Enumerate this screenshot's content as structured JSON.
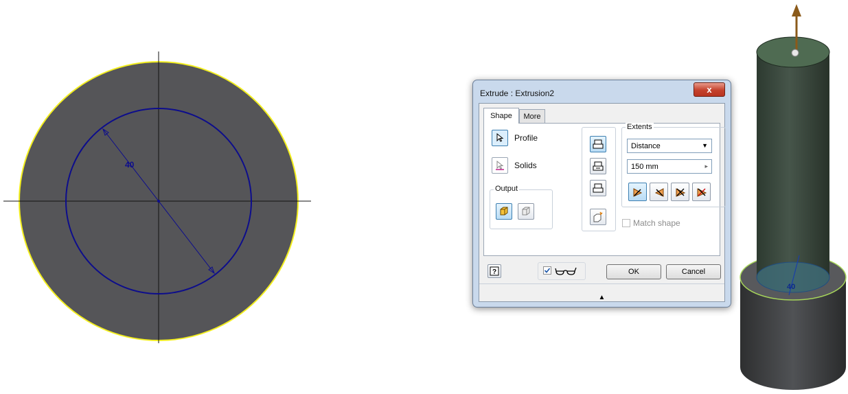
{
  "sketch": {
    "dimension_label": "40"
  },
  "dialog": {
    "title": "Extrude : Extrusion2",
    "close_glyph": "x",
    "tabs": [
      {
        "label": "Shape"
      },
      {
        "label": "More"
      }
    ],
    "profile_label": "Profile",
    "solids_label": "Solids",
    "output": {
      "title": "Output",
      "options": [
        "solid-output-icon",
        "surface-output-icon"
      ]
    },
    "operations": [
      "join-icon",
      "cut-icon",
      "intersect-icon",
      "new-solid-icon"
    ],
    "extents": {
      "title": "Extents",
      "type_value": "Distance",
      "distance_value": "150 mm",
      "direction_icons": [
        "direction-1-icon",
        "direction-2-icon",
        "symmetric-icon",
        "asymmetric-icon"
      ]
    },
    "match_shape_label": "Match shape",
    "help_icon": "help-icon",
    "preview_icon": "glasses-icon",
    "ok_label": "OK",
    "cancel_label": "Cancel",
    "collapse_glyph": "▲"
  },
  "model": {
    "dimension_label": "40"
  },
  "colors": {
    "sketch_fill": "#555558",
    "sketch_outline": "#f2ee1e",
    "profile_circle": "#0d0d8c",
    "body_dark": "#3f4a40",
    "arrow": "#8b5a1a"
  }
}
